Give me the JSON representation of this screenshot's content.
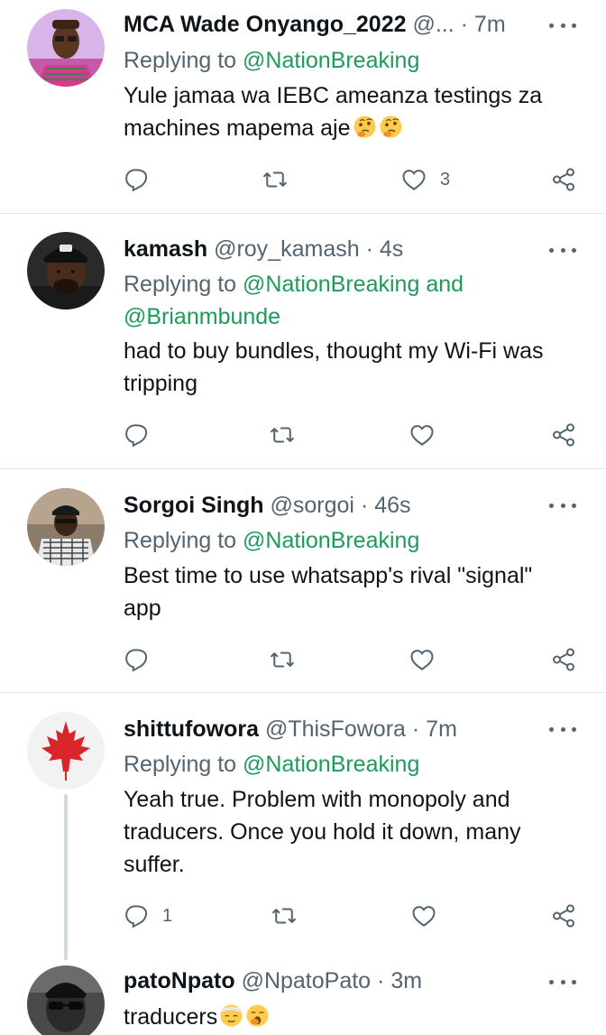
{
  "colors": {
    "accent": "#1d9b5a",
    "muted": "#536471",
    "text": "#0f1419",
    "divider": "#e1e6ea"
  },
  "tweets": [
    {
      "name": "MCA Wade Onyango_2022",
      "handle": "@...",
      "time": "7m",
      "replying_prefix": "Replying to",
      "mentions": [
        "@NationBreaking"
      ],
      "text_lines": [
        "Yule jamaa wa IEBC ameanza testings za",
        "machines mapema aje"
      ],
      "emojis": [
        "thinking-face",
        "thinking-face"
      ],
      "reply_count": "",
      "like_count": "3"
    },
    {
      "name": "kamash",
      "handle": "@roy_kamash",
      "time": "4s",
      "replying_prefix": "Replying to",
      "mentions": [
        "@NationBreaking",
        "@Brianmbunde"
      ],
      "mention_joiner": "and",
      "text_lines": [
        "had to buy bundles, thought my Wi-Fi was",
        "tripping"
      ],
      "reply_count": "",
      "like_count": ""
    },
    {
      "name": "Sorgoi Singh",
      "handle": "@sorgoi",
      "time": "46s",
      "replying_prefix": "Replying to",
      "mentions": [
        "@NationBreaking"
      ],
      "text_lines": [
        "Best time to use whatsapp's rival \"signal\"",
        "app"
      ],
      "reply_count": "",
      "like_count": ""
    },
    {
      "name": "shittufowora",
      "handle": "@ThisFowora",
      "time": "7m",
      "replying_prefix": "Replying to",
      "mentions": [
        "@NationBreaking"
      ],
      "text_lines": [
        "Yeah true. Problem with monopoly and",
        "traducers. Once you hold it down, many",
        "suffer."
      ],
      "reply_count": "1",
      "like_count": ""
    },
    {
      "name": "patoNpato",
      "handle": "@NpatoPato",
      "time": "3m",
      "text_lines": [
        "traducers"
      ],
      "emojis": [
        "bandaged-face",
        "yawning-face"
      ]
    }
  ],
  "separator": "·"
}
